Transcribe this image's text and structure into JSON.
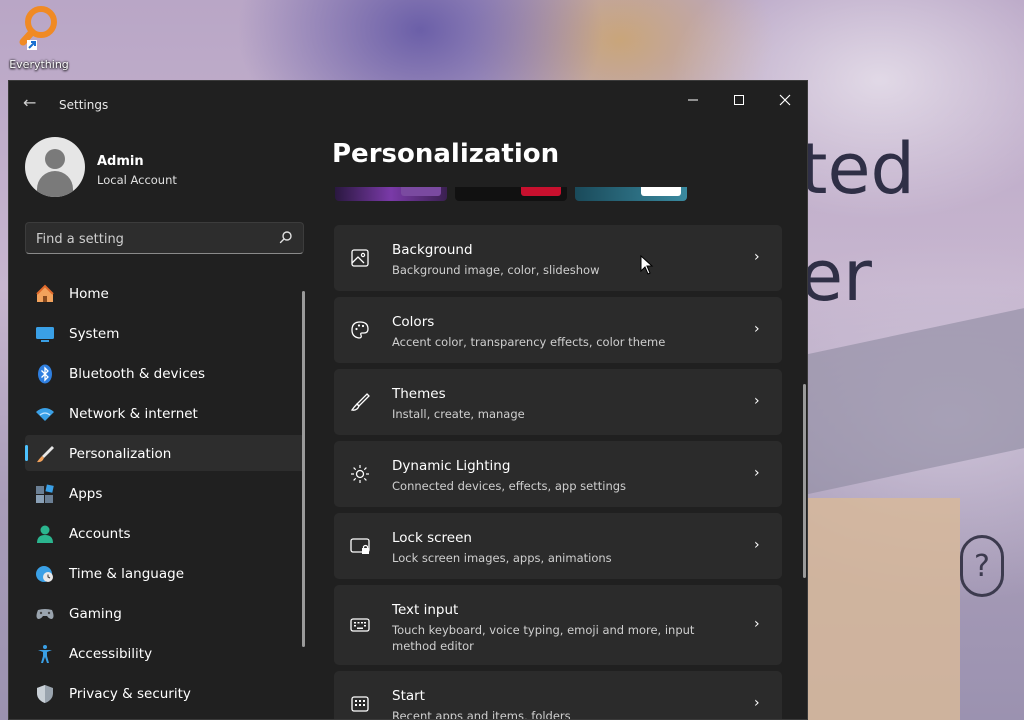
{
  "desktop": {
    "wallpaper_text_1": "ted",
    "wallpaper_text_2": "er",
    "wallpaper_q": "?",
    "icons": [
      {
        "label": "Everything",
        "icon": "everything-search-icon"
      }
    ]
  },
  "window": {
    "title": "Settings",
    "controls": {
      "minimize": "—",
      "maximize": "☐",
      "close": "✕"
    },
    "back_glyph": "←"
  },
  "user": {
    "name": "Admin",
    "account_type": "Local Account"
  },
  "search": {
    "placeholder": "Find a setting"
  },
  "nav": {
    "items": [
      {
        "label": "Home",
        "icon": "home-icon",
        "active": false
      },
      {
        "label": "System",
        "icon": "system-icon",
        "active": false
      },
      {
        "label": "Bluetooth & devices",
        "icon": "bluetooth-icon",
        "active": false
      },
      {
        "label": "Network & internet",
        "icon": "wifi-icon",
        "active": false
      },
      {
        "label": "Personalization",
        "icon": "brush-icon",
        "active": true
      },
      {
        "label": "Apps",
        "icon": "apps-icon",
        "active": false
      },
      {
        "label": "Accounts",
        "icon": "accounts-icon",
        "active": false
      },
      {
        "label": "Time & language",
        "icon": "clock-globe-icon",
        "active": false
      },
      {
        "label": "Gaming",
        "icon": "gamepad-icon",
        "active": false
      },
      {
        "label": "Accessibility",
        "icon": "accessibility-icon",
        "active": false
      },
      {
        "label": "Privacy & security",
        "icon": "shield-icon",
        "active": false
      }
    ]
  },
  "main": {
    "title": "Personalization",
    "cards": [
      {
        "title": "Background",
        "subtitle": "Background image, color, slideshow",
        "icon": "image-icon"
      },
      {
        "title": "Colors",
        "subtitle": "Accent color, transparency effects, color theme",
        "icon": "palette-icon"
      },
      {
        "title": "Themes",
        "subtitle": "Install, create, manage",
        "icon": "brush-icon"
      },
      {
        "title": "Dynamic Lighting",
        "subtitle": "Connected devices, effects, app settings",
        "icon": "lighting-icon"
      },
      {
        "title": "Lock screen",
        "subtitle": "Lock screen images, apps, animations",
        "icon": "lock-screen-icon"
      },
      {
        "title": "Text input",
        "subtitle": "Touch keyboard, voice typing, emoji and more, input method editor",
        "icon": "keyboard-icon"
      },
      {
        "title": "Start",
        "subtitle": "Recent apps and items, folders",
        "icon": "start-icon"
      }
    ],
    "chevron": "›"
  },
  "colors": {
    "accent": "#4cc2ff",
    "window_bg": "#202020",
    "card_bg": "#2b2b2b",
    "nav_active_bg": "#2d2d2d"
  }
}
